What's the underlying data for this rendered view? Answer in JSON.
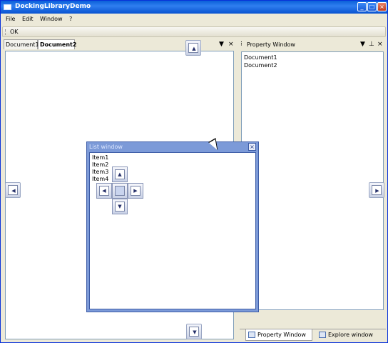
{
  "window": {
    "title": "DockingLibraryDemo",
    "minimize": "_",
    "maximize": "□",
    "close": "×"
  },
  "menu": {
    "items": [
      "File",
      "Edit",
      "Window",
      "?"
    ]
  },
  "toolbar": {
    "ok_label": "OK"
  },
  "documents": {
    "tabs": [
      "Document1",
      "Document2"
    ],
    "active_tab": "Document2",
    "menu_glyph": "▼",
    "close_glyph": "×"
  },
  "property_window": {
    "title": "Property Window",
    "pin_glyph": "⁝",
    "menu_glyph": "▼",
    "autohide_glyph": "⊥",
    "close_glyph": "×",
    "rows": [
      "Document1",
      "Document2"
    ]
  },
  "bottom_tabs": [
    "Property Window",
    "Explore window"
  ],
  "list_window": {
    "title": "List window",
    "close_glyph": "×",
    "items": [
      "Item1",
      "Item2",
      "Item3",
      "Item4"
    ]
  },
  "dock_arrows": {
    "up": "▲",
    "down": "▼",
    "left": "◀",
    "right": "▶"
  },
  "colors": {
    "titlebar": "#0a5fd8",
    "float_frame": "#7c9ad8",
    "pane_border": "#7f9db9"
  }
}
